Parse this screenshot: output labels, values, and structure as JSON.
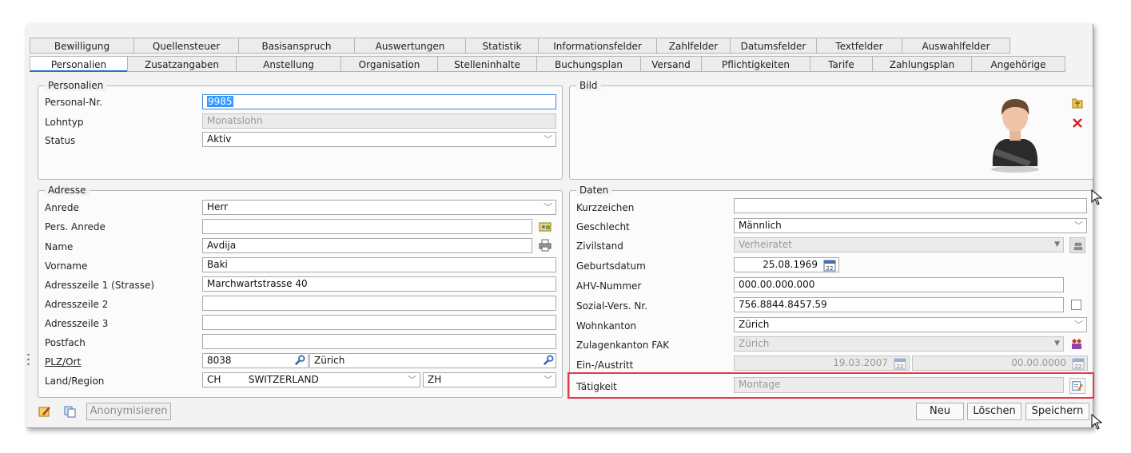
{
  "tabs_row1": [
    "Bewilligung",
    "Quellensteuer",
    "Basisanspruch",
    "Auswertungen",
    "Statistik",
    "Informationsfelder",
    "Zahlfelder",
    "Datumsfelder",
    "Textfelder",
    "Auswahlfelder"
  ],
  "tabs_row2": [
    "Personalien",
    "Zusatzangaben",
    "Anstellung",
    "Organisation",
    "Stelleninhalte",
    "Buchungsplan",
    "Versand",
    "Pflichtigkeiten",
    "Tarife",
    "Zahlungsplan",
    "Angehörige"
  ],
  "active_tab": "Personalien",
  "personalien": {
    "title": "Personalien",
    "personal_nr_label": "Personal-Nr.",
    "personal_nr_value": "9985",
    "lohntyp_label": "Lohntyp",
    "lohntyp_value": "Monatslohn",
    "status_label": "Status",
    "status_value": "Aktiv"
  },
  "bild": {
    "title": "Bild"
  },
  "adresse": {
    "title": "Adresse",
    "anrede_label": "Anrede",
    "anrede_value": "Herr",
    "pers_anrede_label": "Pers. Anrede",
    "pers_anrede_value": "",
    "name_label": "Name",
    "name_value": "Avdija",
    "vorname_label": "Vorname",
    "vorname_value": "Baki",
    "adresszeile1_label": "Adresszeile 1 (Strasse)",
    "adresszeile1_value": "Marchwartstrasse 40",
    "adresszeile2_label": "Adresszeile 2",
    "adresszeile2_value": "",
    "adresszeile3_label": "Adresszeile 3",
    "adresszeile3_value": "",
    "postfach_label": "Postfach",
    "postfach_value": "",
    "plz_ort_label": "PLZ/Ort",
    "plz_value": "8038",
    "ort_value": "Zürich",
    "land_label": "Land/Region",
    "land_code": "CH",
    "land_name": "SWITZERLAND",
    "kanton_value": "ZH"
  },
  "daten": {
    "title": "Daten",
    "kurzzeichen_label": "Kurzzeichen",
    "kurzzeichen_value": "",
    "geschlecht_label": "Geschlecht",
    "geschlecht_value": "Männlich",
    "zivilstand_label": "Zivilstand",
    "zivilstand_value": "Verheiratet",
    "geburtsdatum_label": "Geburtsdatum",
    "geburtsdatum_value": "25.08.1969",
    "ahv_label": "AHV-Nummer",
    "ahv_value": "000.00.000.000",
    "sozial_label": "Sozial-Vers. Nr.",
    "sozial_value": "756.8844.8457.59",
    "wohnkanton_label": "Wohnkanton",
    "wohnkanton_value": "Zürich",
    "zulagenkanton_label": "Zulagenkanton FAK",
    "zulagenkanton_value": "Zürich",
    "ein_austritt_label": "Ein-/Austritt",
    "eintritt_value": "19.03.2007",
    "austritt_value": "00.00.0000",
    "taetigkeit_label": "Tätigkeit",
    "taetigkeit_value": "Montage",
    "calendar_day": "22"
  },
  "buttons": {
    "anonymisieren": "Anonymisieren",
    "neu": "Neu",
    "loeschen": "Löschen",
    "speichern": "Speichern"
  },
  "colors": {
    "accent": "#2a6fc9",
    "highlight_frame": "#e23c4a",
    "selection": "#3399ff"
  }
}
